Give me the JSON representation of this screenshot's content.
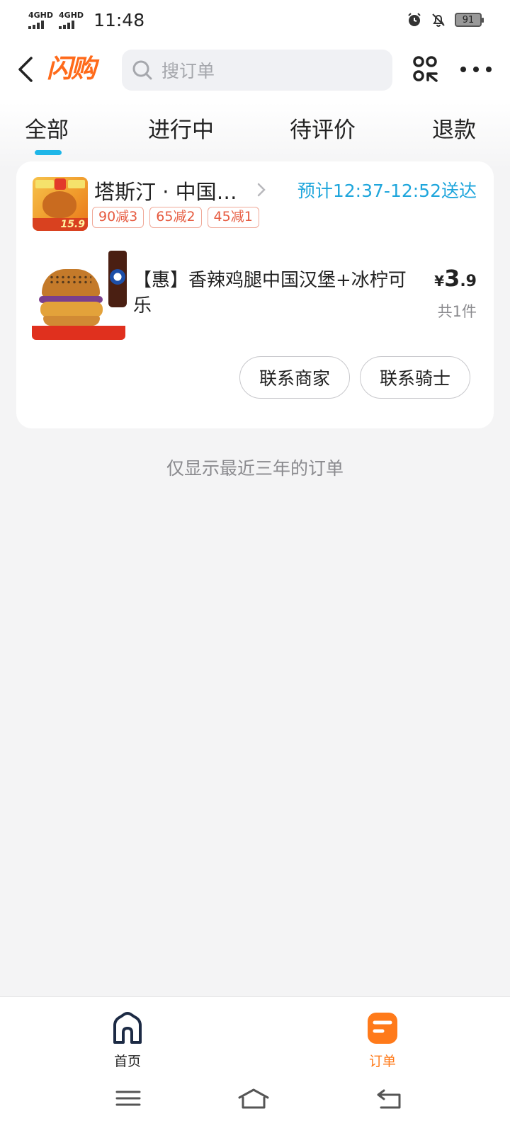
{
  "status_bar": {
    "network_1": "4GHD",
    "network_2": "4GHD",
    "time": "11:48",
    "battery": "91",
    "icons": [
      "alarm-icon",
      "notifications-off-icon",
      "battery-icon"
    ]
  },
  "header": {
    "logo_text": "闪购",
    "search_placeholder": "搜订单"
  },
  "tabs": [
    {
      "label": "全部",
      "active": true
    },
    {
      "label": "进行中",
      "active": false
    },
    {
      "label": "待评价",
      "active": false
    },
    {
      "label": "退款",
      "active": false
    }
  ],
  "order": {
    "store_name": "塔斯汀 · 中国…",
    "store_thumb_price": "15.9",
    "eta": "预计12:37-12:52送达",
    "promos": [
      "90减3",
      "65减2",
      "45减1"
    ],
    "item": {
      "title": "【惠】香辣鸡腿中国汉堡+冰柠可乐",
      "price_symbol": "¥",
      "price_int": "3",
      "price_dec": ".9",
      "quantity": "共1件"
    },
    "actions": {
      "contact_merchant": "联系商家",
      "contact_rider": "联系骑士"
    }
  },
  "footnote": "仅显示最近三年的订单",
  "bottom_nav": {
    "home": "首页",
    "orders": "订单"
  },
  "colors": {
    "accent_blue": "#1fb6e8",
    "eta_blue": "#1fa6dc",
    "brand_orange": "#ff6a1a",
    "promo_red": "#e65a3f",
    "nav_active": "#ff7a1a"
  }
}
